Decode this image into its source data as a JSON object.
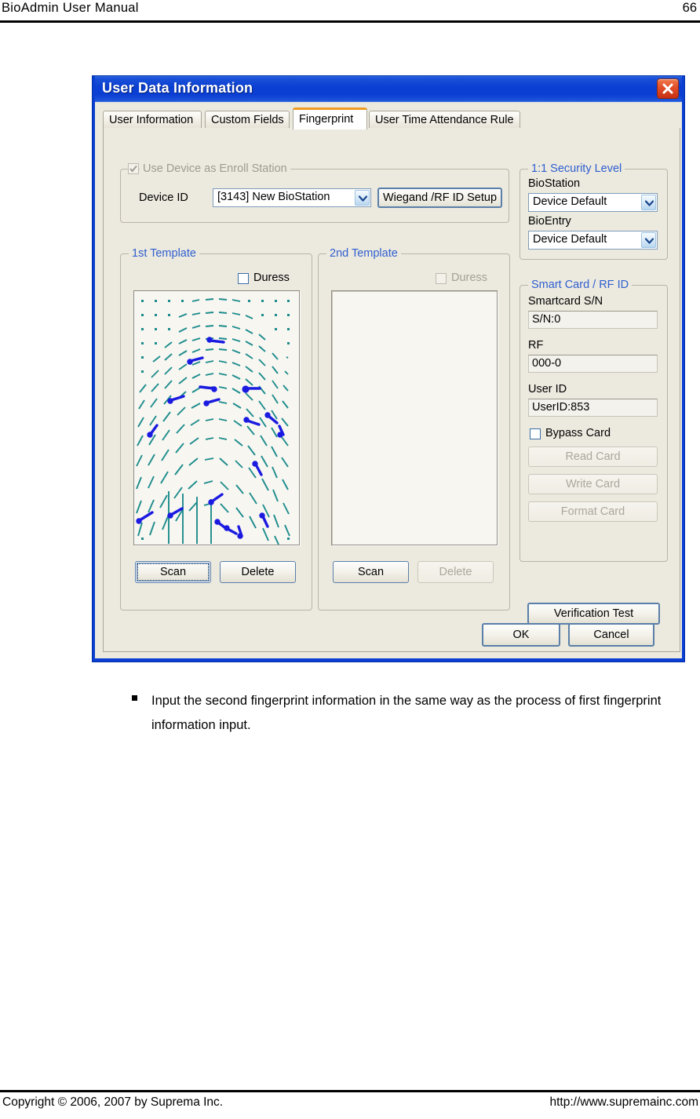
{
  "page": {
    "header_title": "BioAdmin  User  Manual",
    "page_number": "66",
    "footer_copyright": "Copyright © 2006, 2007 by Suprema Inc.",
    "footer_url": "http://www.supremainc.com",
    "body_note": "Input the second fingerprint information in the same way as the process of first fingerprint information input."
  },
  "dialog": {
    "title": "User Data Information",
    "close_icon": "close-icon",
    "tabs": [
      {
        "label": "User Information",
        "active": false
      },
      {
        "label": "Custom Fields",
        "active": false
      },
      {
        "label": "Fingerprint",
        "active": true
      },
      {
        "label": "User Time Attendance Rule",
        "active": false
      }
    ],
    "enroll_station": {
      "legend": "Use Device as Enroll Station",
      "checkbox_checked": true,
      "checkbox_disabled": true,
      "device_id_label": "Device ID",
      "device_id_value": "[3143] New BioStation",
      "wiegand_button": "Wiegand /RF ID Setup"
    },
    "template1": {
      "legend": "1st Template",
      "duress_label": "Duress",
      "duress_checked": false,
      "duress_disabled": false,
      "scan_button": "Scan",
      "delete_button": "Delete",
      "scan_focused": true,
      "delete_disabled": false,
      "has_image": true
    },
    "template2": {
      "legend": "2nd Template",
      "duress_label": "Duress",
      "duress_checked": false,
      "duress_disabled": true,
      "scan_button": "Scan",
      "delete_button": "Delete",
      "scan_focused": false,
      "delete_disabled": true,
      "has_image": false
    },
    "security_level": {
      "legend": "1:1 Security Level",
      "biostation_label": "BioStation",
      "biostation_value": "Device Default",
      "bioentry_label": "BioEntry",
      "bioentry_value": "Device Default"
    },
    "smart_card": {
      "legend": "Smart Card / RF ID",
      "smartcard_sn_label": "Smartcard S/N",
      "smartcard_sn_value": "S/N:0",
      "rf_label": "RF",
      "rf_value": "000-0",
      "user_id_label": "User ID",
      "user_id_value": "UserID:853",
      "bypass_label": "Bypass Card",
      "bypass_checked": false,
      "read_card_button": "Read Card",
      "write_card_button": "Write Card",
      "format_card_button": "Format Card",
      "card_buttons_disabled": true
    },
    "verification_button": "Verification Test",
    "ok_button": "OK",
    "cancel_button": "Cancel"
  },
  "colors": {
    "titlebar_blue": "#0b3fd3",
    "dialog_face": "#ece9df",
    "group_legend_blue": "#2f5fcf",
    "active_tab_accent": "#ef9a20",
    "close_red": "#c72f12",
    "ridge_teal": "#1c8c8c",
    "minutia_blue": "#1a1ae0"
  }
}
